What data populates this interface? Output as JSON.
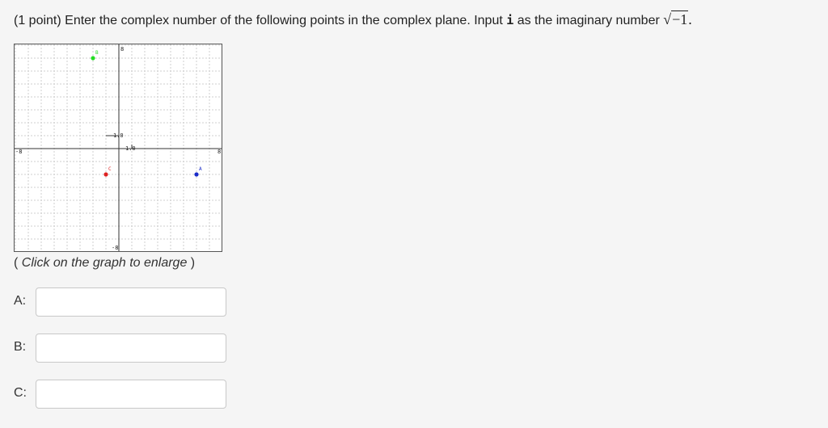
{
  "problem": {
    "prefix": "(1 point) Enter the complex number of the following points in the complex plane. Input ",
    "imag_symbol": "i",
    "mid": " as the imaginary number ",
    "sqrt_sign": "√",
    "sqrt_arg": "−1",
    "suffix": "."
  },
  "graph": {
    "ticks": {
      "x_min": "-8",
      "x_max": "8",
      "y_max": "8",
      "y_min": "-8",
      "x_unit": "1.0",
      "y_unit": "1.0"
    },
    "points": [
      {
        "label": "A",
        "x": 6,
        "y": -2,
        "color": "#1a2cc8"
      },
      {
        "label": "B",
        "x": -2,
        "y": 7,
        "color": "#22dd22"
      },
      {
        "label": "C",
        "x": -1,
        "y": -2,
        "color": "#dd2222"
      }
    ]
  },
  "hint": {
    "open": "( ",
    "text": "Click on the graph to enlarge",
    "close": " )"
  },
  "answers": [
    {
      "label": "A:",
      "value": ""
    },
    {
      "label": "B:",
      "value": ""
    },
    {
      "label": "C:",
      "value": ""
    }
  ]
}
